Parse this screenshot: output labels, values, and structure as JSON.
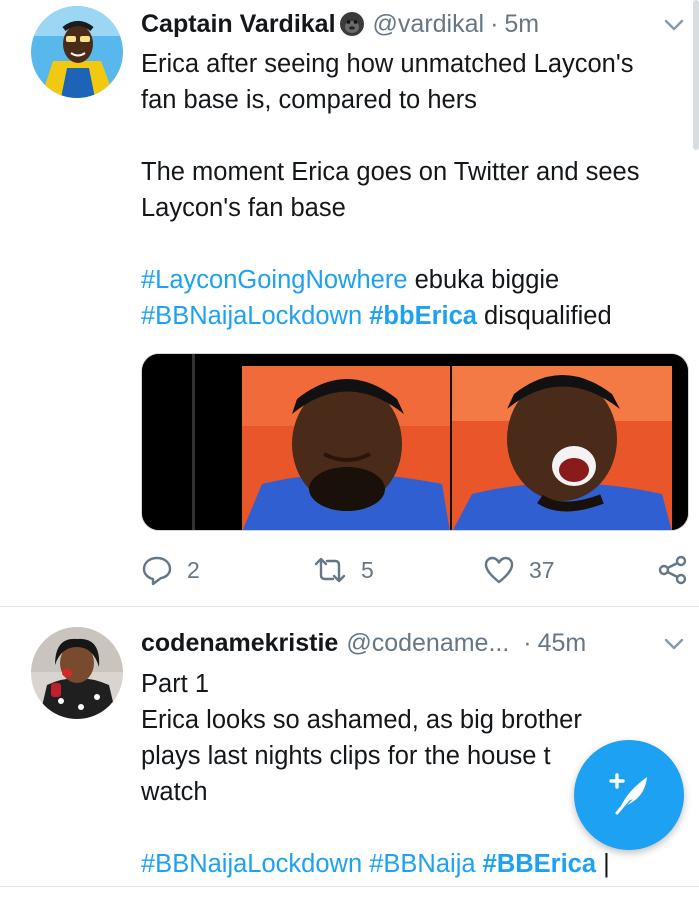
{
  "colors": {
    "link": "#1da1f2",
    "text": "#14171a",
    "muted": "#657786",
    "divider": "#e1e8ed",
    "fab": "#1da1f2"
  },
  "tweets": [
    {
      "display_name": "Captain Vardikal",
      "name_emoji_icon": "gorilla-emoji-icon",
      "handle": "@vardikal",
      "separator": "·",
      "time": "5m",
      "text": {
        "line1": "Erica after seeing how unmatched Laycon's",
        "line2": "fan base is, compared to hers",
        "line3": "The moment Erica goes on Twitter and sees",
        "line4": "Laycon's fan base",
        "tag1": "#LayconGoingNowhere",
        "plain1": " ebuka biggie",
        "tag2": "#BBNaijaLockdown",
        "tag3": "#bbErica",
        "plain2": " disqualified"
      },
      "media_icon": "meme-image-two-panel-icon",
      "actions": {
        "replies": "2",
        "retweets": "5",
        "likes": "37"
      }
    },
    {
      "display_name": "codenamekristie",
      "handle": "@codename...",
      "separator": "·",
      "time": "45m",
      "text": {
        "line1": "Part 1",
        "line2": "Erica looks so ashamed, as big brother",
        "line3": "plays last nights clips for the house t",
        "line4": "watch",
        "tag1": "#BBNaijaLockdown",
        "tag2": "#BBNaija",
        "tag3": "#BBErica",
        "trail": " |"
      }
    }
  ],
  "fab": {
    "icon": "compose-feather-plus-icon"
  }
}
